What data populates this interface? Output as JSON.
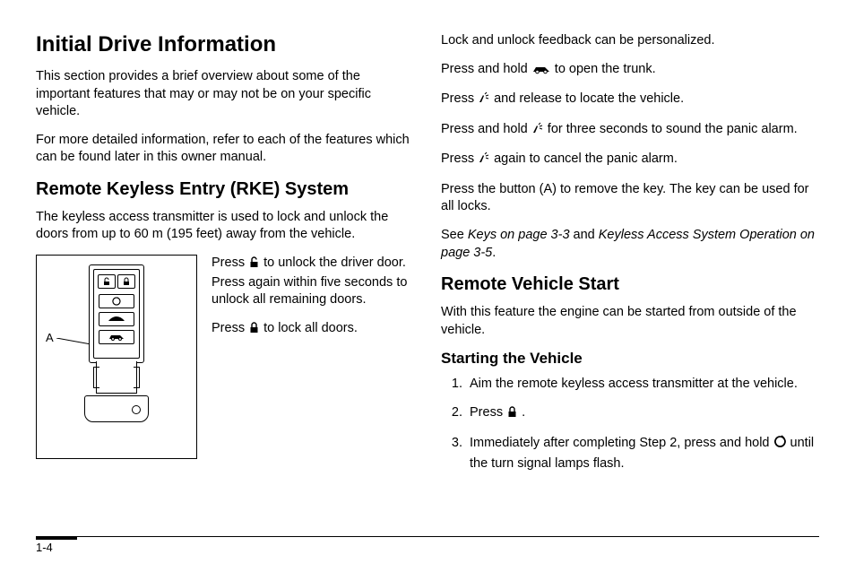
{
  "left": {
    "h1": "Initial Drive Information",
    "p1": "This section provides a brief overview about some of the important features that may or may not be on your specific vehicle.",
    "p2": "For more detailed information, refer to each of the features which can be found later in this owner manual.",
    "h2": "Remote Keyless Entry (RKE) System",
    "p3": "The keyless access transmitter is used to lock and unlock the doors from up to 60 m (195 feet) away from the vehicle.",
    "figLabel": "A",
    "fp1a": "Press ",
    "fp1b": " to unlock the driver door. Press again within five seconds to unlock all remaining doors.",
    "fp2a": "Press ",
    "fp2b": " to lock all doors."
  },
  "right": {
    "p1": "Lock and unlock feedback can be personalized.",
    "p2a": "Press and hold ",
    "p2b": " to open the trunk.",
    "p3a": "Press ",
    "p3b": " and release to locate the vehicle.",
    "p4a": "Press and hold ",
    "p4b": " for three seconds to sound the panic alarm.",
    "p5a": "Press ",
    "p5b": " again to cancel the panic alarm.",
    "p6": "Press the button (A) to remove the key. The key can be used for all locks.",
    "p7a": "See ",
    "p7b": "Keys on page 3‑3",
    "p7c": " and ",
    "p7d": "Keyless Access System Operation on page 3‑5",
    "p7e": ".",
    "h2": "Remote Vehicle Start",
    "p8": "With this feature the engine can be started from outside of the vehicle.",
    "h3": "Starting the Vehicle",
    "li1": "Aim the remote keyless access transmitter at the vehicle.",
    "li2a": "Press ",
    "li2b": " .",
    "li3a": "Immediately after completing Step 2, press and hold ",
    "li3b": " until the turn signal lamps flash."
  },
  "footer": {
    "page": "1-4"
  }
}
